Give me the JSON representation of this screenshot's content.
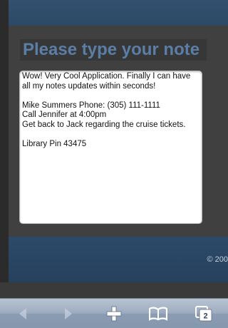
{
  "page": {
    "heading": "Please type your note",
    "note_text": "Wow! Very Cool Application. Finally I can have all my notes updates within seconds!\n\nMike Summers Phone: (305) 111-1111\nCall Jennifer at 4:00pm\nGet back to Jack regarding the cruise tickets.\n\nLibrary Pin 43475",
    "footer_text": "© 200"
  },
  "toolbar": {
    "items": [
      {
        "icon": "back-arrow-icon",
        "enabled": false
      },
      {
        "icon": "forward-arrow-icon",
        "enabled": false
      },
      {
        "icon": "plus-icon",
        "enabled": true
      },
      {
        "icon": "bookmarks-icon",
        "enabled": true
      },
      {
        "icon": "pages-icon",
        "enabled": true
      }
    ],
    "pages_count": "2"
  },
  "colors": {
    "heading_text": "#5b7ea6",
    "banner": "#2c4966",
    "page_bg": "#404040",
    "toolbar": "#9babbf"
  }
}
